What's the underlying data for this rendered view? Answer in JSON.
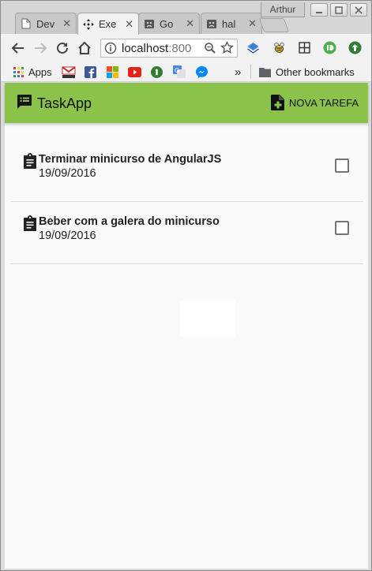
{
  "browser": {
    "user": "Arthur",
    "tabs": [
      {
        "title": "Dev",
        "icon": "document-icon",
        "active": false
      },
      {
        "title": "Exe",
        "icon": "move-icon",
        "active": true
      },
      {
        "title": "Go",
        "icon": "sad-face-icon",
        "active": false
      },
      {
        "title": "hal",
        "icon": "sad-face-icon",
        "active": false
      }
    ],
    "close_glyph": "✕",
    "address": {
      "host": "localhost",
      "port": ":800"
    },
    "bookmarks": {
      "apps_label": "Apps",
      "overflow_glyph": "»",
      "other_label": "Other bookmarks"
    }
  },
  "app": {
    "title": "TaskApp",
    "new_task_label": "NOVA TAREFA",
    "brand_color": "#8bc34a",
    "tasks": [
      {
        "title": "Terminar minicurso de AngularJS",
        "date": "19/09/2016",
        "done": false
      },
      {
        "title": "Beber com a galera do minicurso",
        "date": "19/09/2016",
        "done": false
      }
    ]
  }
}
